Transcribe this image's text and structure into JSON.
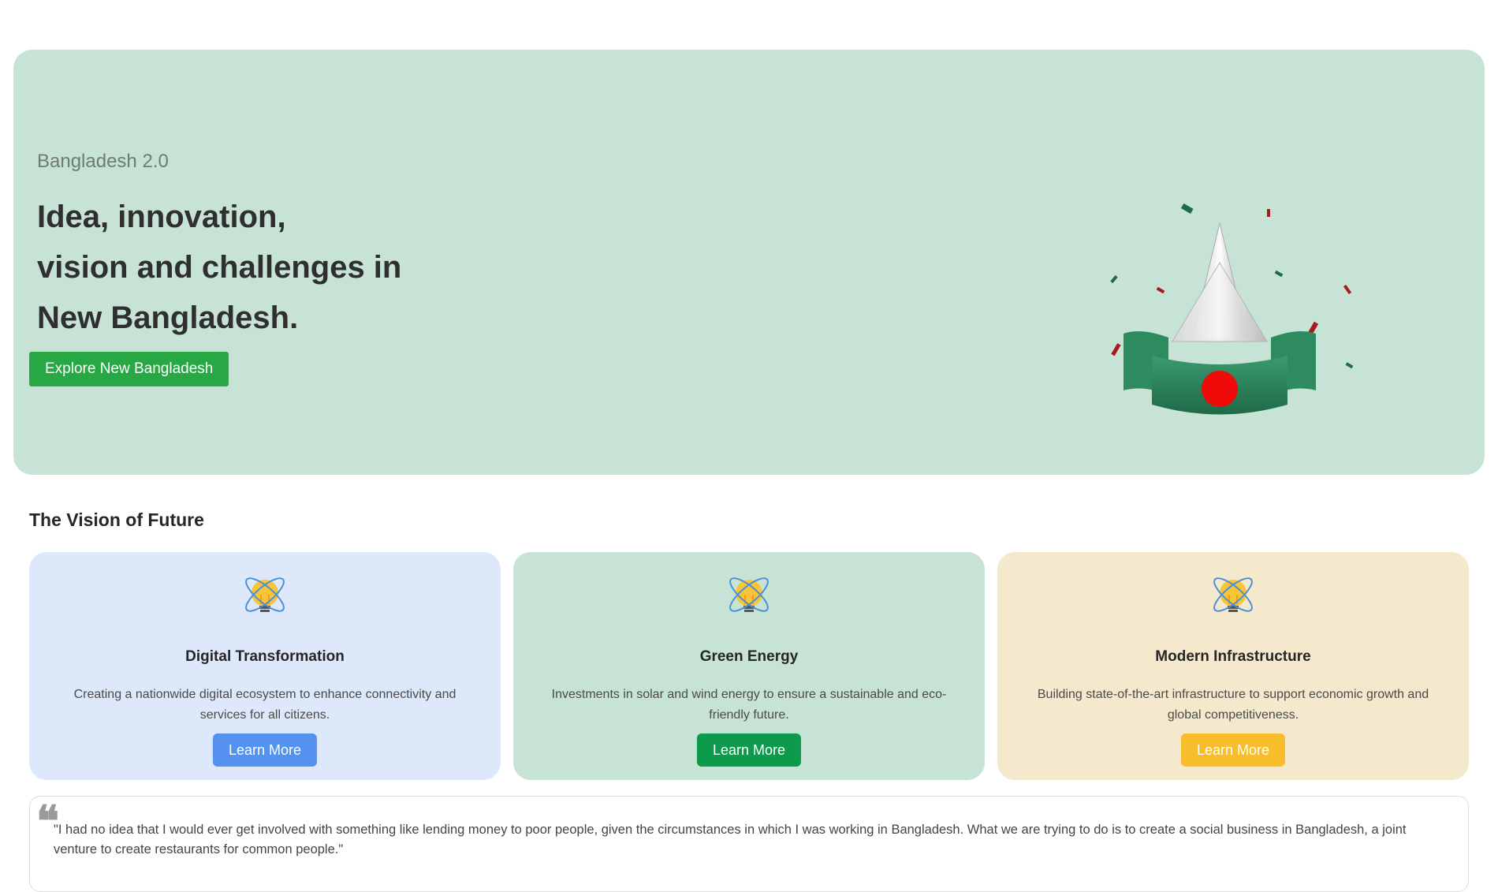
{
  "hero": {
    "kicker": "Bangladesh 2.0",
    "title_lines": [
      "Idea, innovation,",
      "vision and challenges in",
      "New Bangladesh."
    ],
    "button_label": "Explore New Bangladesh"
  },
  "vision": {
    "title": "The Vision of Future",
    "cards": [
      {
        "title": "Digital Transformation",
        "description": "Creating a nationwide digital ecosystem to enhance connectivity and services for all citizens.",
        "button_label": "Learn More",
        "bg_color": "#dde8fb",
        "button_color": "#5592f0",
        "icon": "lightbulb-atom-icon"
      },
      {
        "title": "Green Energy",
        "description": "Investments in solar and wind energy to ensure a sustainable and eco-friendly future.",
        "button_label": "Learn More",
        "bg_color": "#c7e3d5",
        "button_color": "#0d9a4d",
        "icon": "lightbulb-atom-icon"
      },
      {
        "title": "Modern Infrastructure",
        "description": "Building state-of-the-art infrastructure to support economic growth and global competitiveness.",
        "button_label": "Learn More",
        "bg_color": "#f5e9cd",
        "button_color": "#f8bd2a",
        "icon": "lightbulb-atom-icon"
      }
    ]
  },
  "quote": {
    "mark": "❝",
    "text": "\"I had no idea that I would ever get involved with something like lending money to poor people, given the circumstances in which I was working in Bangladesh. What we are trying to do is to create a social business in Bangladesh, a joint venture to create restaurants for common people.\""
  },
  "colors": {
    "hero_bg": "#c7e3d5",
    "primary_button": "#28a745",
    "flag_green": "#2e7d5b",
    "flag_red": "#f00a0a"
  }
}
